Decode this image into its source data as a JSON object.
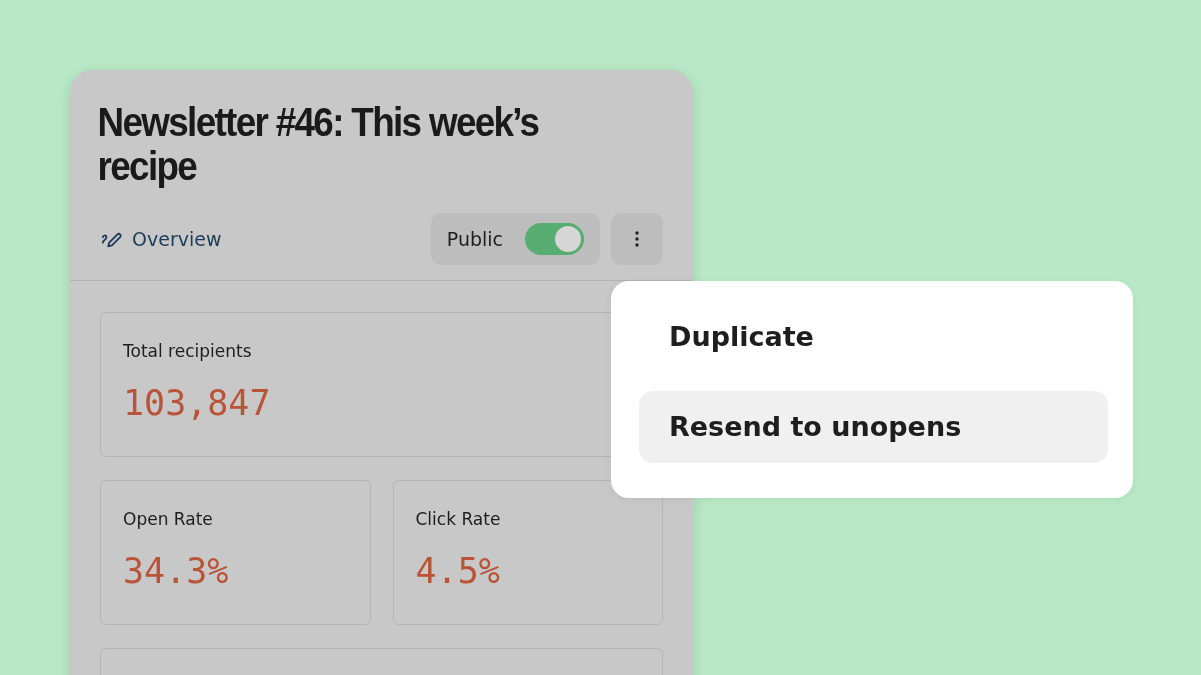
{
  "card": {
    "title": "Newsletter #46: This week’s recipe",
    "nav_link": {
      "label": "Overview"
    },
    "visibility_toggle": {
      "label": "Public",
      "on": true
    },
    "stats": [
      {
        "label": "Total recipients",
        "value": "103,847",
        "kind": "wide"
      },
      {
        "label": "Open Rate",
        "value": "34.3%",
        "kind": "half"
      },
      {
        "label": "Click Rate",
        "value": "4.5%",
        "kind": "half"
      },
      {
        "kind": "empty"
      }
    ]
  },
  "menu": {
    "items": [
      {
        "label": "Duplicate",
        "selected": false
      },
      {
        "label": "Resend to unopens",
        "selected": true
      }
    ]
  }
}
